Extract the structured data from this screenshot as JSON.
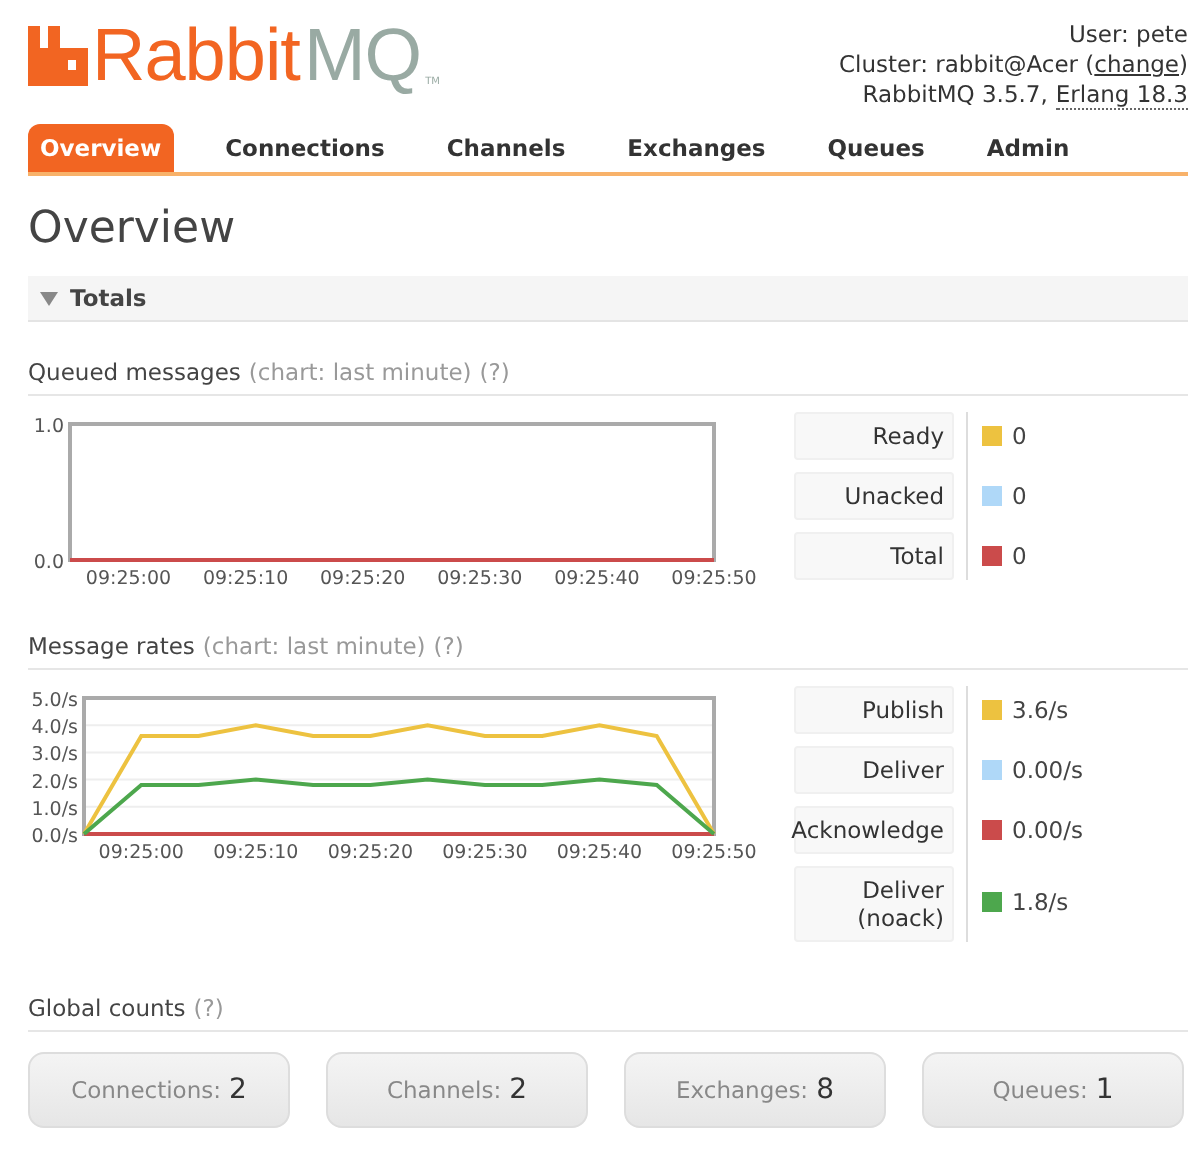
{
  "logo": {
    "brand": "Rabbit",
    "suffix": "MQ",
    "tm": "TM"
  },
  "info": {
    "user": "User: pete",
    "cluster_prefix": "Cluster: rabbit@Acer (",
    "cluster_link": "change",
    "cluster_suffix": ")",
    "version": "RabbitMQ 3.5.7,",
    "erlang": "Erlang 18.3"
  },
  "tabs": [
    {
      "label": "Overview",
      "selected": true
    },
    {
      "label": "Connections",
      "selected": false
    },
    {
      "label": "Channels",
      "selected": false
    },
    {
      "label": "Exchanges",
      "selected": false
    },
    {
      "label": "Queues",
      "selected": false
    },
    {
      "label": "Admin",
      "selected": false
    }
  ],
  "page_title": "Overview",
  "totals": {
    "label": "Totals",
    "expanded": true
  },
  "sections": [
    {
      "title": "Queued messages",
      "note": "(chart: last minute)",
      "help": "(?)",
      "chart_data": {
        "type": "line",
        "categories": [
          null,
          "09:25:00",
          null,
          "09:25:10",
          null,
          "09:25:20",
          null,
          "09:25:30",
          null,
          "09:25:40",
          null,
          "09:25:50"
        ],
        "ylim": [
          0,
          1
        ],
        "yticks": [
          {
            "value": 0,
            "label": "0.0"
          },
          {
            "value": 1,
            "label": "1.0"
          }
        ],
        "series": [
          {
            "name": "Ready",
            "color": "#edc240",
            "values": [
              null,
              null,
              null,
              null,
              null,
              null,
              null,
              null,
              null,
              null,
              null,
              null
            ]
          },
          {
            "name": "Unacked",
            "color": "#afd8f8",
            "values": [
              null,
              null,
              null,
              null,
              null,
              null,
              null,
              null,
              null,
              null,
              null,
              null
            ]
          },
          {
            "name": "Total",
            "color": "#cb4b4b",
            "values": [
              0,
              0,
              0,
              0,
              0,
              0,
              0,
              0,
              0,
              0,
              0,
              0
            ]
          }
        ]
      },
      "legend_values": [
        "0",
        "0",
        "0"
      ]
    },
    {
      "title": "Message rates",
      "note": "(chart: last minute)",
      "help": "(?)",
      "chart_data": {
        "type": "line",
        "categories": [
          null,
          "09:25:00",
          null,
          "09:25:10",
          null,
          "09:25:20",
          null,
          "09:25:30",
          null,
          "09:25:40",
          null,
          "09:25:50"
        ],
        "ylim": [
          0,
          5
        ],
        "grid": true,
        "yticks": [
          {
            "value": 0,
            "label": "0.0/s"
          },
          {
            "value": 1,
            "label": "1.0/s"
          },
          {
            "value": 2,
            "label": "2.0/s"
          },
          {
            "value": 3,
            "label": "3.0/s"
          },
          {
            "value": 4,
            "label": "4.0/s"
          },
          {
            "value": 5,
            "label": "5.0/s"
          }
        ],
        "series": [
          {
            "name": "Publish",
            "color": "#edc240",
            "values": [
              0,
              3.6,
              3.6,
              4,
              3.6,
              3.6,
              4,
              3.6,
              3.6,
              4,
              3.6,
              0
            ]
          },
          {
            "name": "Deliver",
            "color": "#afd8f8",
            "values": [
              null,
              null,
              null,
              null,
              null,
              null,
              null,
              null,
              null,
              null,
              null,
              null
            ]
          },
          {
            "name": "Acknowledge",
            "color": "#cb4b4b",
            "values": [
              0,
              0,
              0,
              0,
              0,
              0,
              0,
              0,
              0,
              0,
              0,
              0
            ]
          },
          {
            "name": "Deliver (noack)",
            "color": "#4da74d",
            "values": [
              0,
              1.8,
              1.8,
              2,
              1.8,
              1.8,
              2,
              1.8,
              1.8,
              2,
              1.8,
              0
            ]
          }
        ]
      },
      "legend_values": [
        "3.6/s",
        "0.00/s",
        "0.00/s",
        "1.8/s"
      ]
    }
  ],
  "global_counts": {
    "title": "Global counts",
    "help": "(?)",
    "items": [
      {
        "label": "Connections:",
        "count": "2"
      },
      {
        "label": "Channels:",
        "count": "2"
      },
      {
        "label": "Exchanges:",
        "count": "8"
      },
      {
        "label": "Queues:",
        "count": "1"
      }
    ]
  }
}
